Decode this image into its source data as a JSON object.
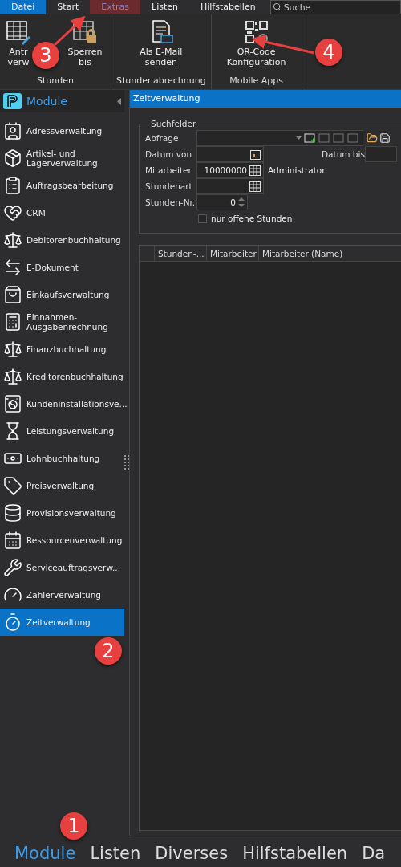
{
  "menu_tabs": [
    {
      "label": "Datei",
      "kind": "file",
      "selected": false
    },
    {
      "label": "Start",
      "kind": "tab",
      "selected": false
    },
    {
      "label": "Extras",
      "kind": "tab",
      "selected": true
    },
    {
      "label": "Listen",
      "kind": "tab",
      "selected": false
    },
    {
      "label": "Hilfstabellen",
      "kind": "tab",
      "selected": false
    }
  ],
  "search": {
    "placeholder": "Suche"
  },
  "ribbon_groups": [
    {
      "label": "Stunden",
      "buttons": [
        {
          "lines": [
            "Antr",
            "verw"
          ]
        },
        {
          "lines": [
            "Sperren",
            "bis"
          ]
        }
      ]
    },
    {
      "label": "Stundenabrechnung",
      "buttons": [
        {
          "lines": [
            "Als E-Mail",
            "senden"
          ]
        }
      ]
    },
    {
      "label": "Mobile Apps",
      "buttons": [
        {
          "lines": [
            "QR-Code",
            "Konfiguration"
          ]
        }
      ]
    }
  ],
  "sidebar": {
    "title": "Module",
    "items": [
      {
        "label": "Adressverwaltung",
        "selected": false
      },
      {
        "label": "Artikel- und Lagerverwaltung",
        "selected": false
      },
      {
        "label": "Auftragsbearbeitung",
        "selected": false
      },
      {
        "label": "CRM",
        "selected": false
      },
      {
        "label": "Debitorenbuchhaltung",
        "selected": false
      },
      {
        "label": "E-Dokument",
        "selected": false
      },
      {
        "label": "Einkaufsverwaltung",
        "selected": false
      },
      {
        "label": "Einnahmen-Ausgabenrechnung",
        "selected": false
      },
      {
        "label": "Finanzbuchhaltung",
        "selected": false
      },
      {
        "label": "Kreditorenbuchhaltung",
        "selected": false
      },
      {
        "label": "Kundeninstallationsve...",
        "selected": false
      },
      {
        "label": "Leistungsverwaltung",
        "selected": false
      },
      {
        "label": "Lohnbuchhaltung",
        "selected": false
      },
      {
        "label": "Preisverwaltung",
        "selected": false
      },
      {
        "label": "Provisionsverwaltung",
        "selected": false
      },
      {
        "label": "Ressourcenverwaltung",
        "selected": false
      },
      {
        "label": "Serviceauftragsverw...",
        "selected": false
      },
      {
        "label": "Zählerverwaltung",
        "selected": false
      },
      {
        "label": "Zeitverwaltung",
        "selected": true
      }
    ]
  },
  "panel": {
    "title": "Zeitverwaltung",
    "group_title": "Suchfelder",
    "fields": {
      "abfrage": {
        "label": "Abfrage"
      },
      "datum_von": {
        "label": "Datum von"
      },
      "datum_bis": {
        "label": "Datum bis"
      },
      "mitarbeiter": {
        "label": "Mitarbeiter",
        "value": "10000000",
        "name": "Administrator"
      },
      "stundenart": {
        "label": "Stundenart"
      },
      "stunden_nr": {
        "label": "Stunden-Nr.",
        "value": "0"
      }
    },
    "checkbox": {
      "label": "nur offene Stunden",
      "checked": false
    },
    "table": {
      "columns": [
        "Stunden-...",
        "Mitarbeiter",
        "Mitarbeiter (Name)"
      ]
    }
  },
  "bottom_tabs": [
    {
      "label": "Module",
      "selected": true
    },
    {
      "label": "Listen",
      "selected": false
    },
    {
      "label": "Diverses",
      "selected": false
    },
    {
      "label": "Hilfstabellen",
      "selected": false
    },
    {
      "label": "Da",
      "selected": false
    }
  ],
  "annotations": [
    {
      "number": "1"
    },
    {
      "number": "2"
    },
    {
      "number": "3"
    },
    {
      "number": "4"
    }
  ]
}
